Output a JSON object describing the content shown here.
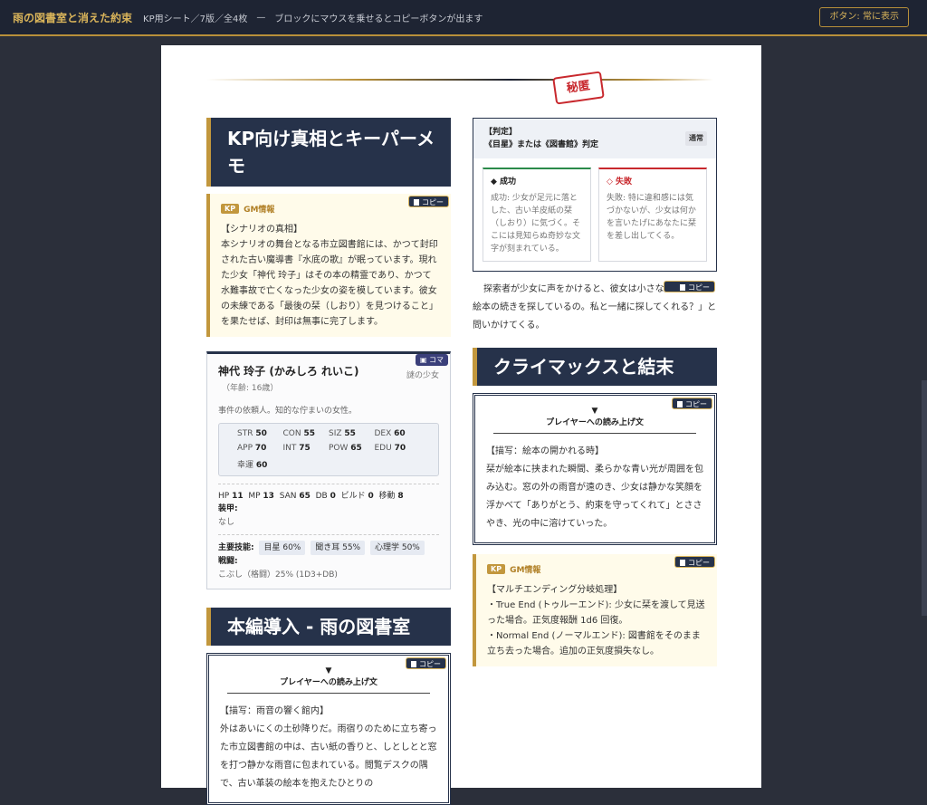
{
  "header": {
    "title": "雨の図書室と消えた約束",
    "subtitle": "KP用シート／7版／全4枚",
    "separator": "—",
    "hint": "ブロックにマウスを乗せるとコピーボタンが出ます",
    "button_label": "ボタン: 常に表示"
  },
  "stamp": "秘匿",
  "copy_label": "コピー",
  "left": {
    "section1_title": "KP向け真相とキーパーメモ",
    "gm1": {
      "badge": "KP",
      "label": "GM情報",
      "heading": "【シナリオの真相】",
      "body": "本シナリオの舞台となる市立図書館には、かつて封印された古い魔導書『水底の歌』が眠っています。現れた少女「神代 玲子」はその本の精霊であり、かつて水難事故で亡くなった少女の姿を模しています。彼女の未練である「最後の栞（しおり）を見つけること」を果たせば、封印は無事に完了します。"
    },
    "npc": {
      "koma_label": "コマ",
      "name": "神代 玲子 (かみしろ れいこ)",
      "role": "謎の少女",
      "age": "（年齢: 16歳）",
      "desc": "事件の依頼人。知的な佇まいの女性。",
      "stats": [
        {
          "k": "STR",
          "v": "50"
        },
        {
          "k": "CON",
          "v": "55"
        },
        {
          "k": "SIZ",
          "v": "55"
        },
        {
          "k": "DEX",
          "v": "60"
        },
        {
          "k": "APP",
          "v": "70"
        },
        {
          "k": "INT",
          "v": "75"
        },
        {
          "k": "POW",
          "v": "65"
        },
        {
          "k": "EDU",
          "v": "70"
        },
        {
          "k": "幸運",
          "v": "60"
        }
      ],
      "hp_k": "HP",
      "hp_v": "11",
      "mp_k": "MP",
      "mp_v": "13",
      "san_k": "SAN",
      "san_v": "65",
      "db_k": "DB",
      "db_v": "0",
      "build_k": "ビルド",
      "build_v": "0",
      "move_k": "移動",
      "move_v": "8",
      "armor_label": "装甲:",
      "armor_value": "なし",
      "skills_label": "主要技能:",
      "skills": [
        "目星 60%",
        "聞き耳 55%",
        "心理学 50%"
      ],
      "combat_label": "戦闘:",
      "combat_value": "こぶし（格闘）25% (1D3+DB)"
    },
    "section2_title": "本編導入 - 雨の図書室",
    "read1": {
      "mark": "▼",
      "title": "プレイヤーへの読み上げ文",
      "heading": "【描写：雨音の響く館内】",
      "body": "外はあいにくの土砂降りだ。雨宿りのために立ち寄った市立図書館の中は、古い紙の香りと、しとしとと窓を打つ静かな雨音に包まれている。閲覧デスクの隅で、古い革装の絵本を抱えたひとりの"
    }
  },
  "right": {
    "judge": {
      "label": "【判定】",
      "title": "《目星》または《図書館》判定",
      "difficulty": "通常",
      "success_label": "◆ 成功",
      "success_text": "成功: 少女が足元に落とした、古い羊皮紙の栞（しおり）に気づく。そこには見知らぬ奇妙な文字が刻まれている。",
      "fail_label": "◇ 失敗",
      "fail_text": "失敗: 特に違和感には気づかないが、少女は何かを言いたげにあなたに栞を差し出してくる。"
    },
    "prose": "探索者が少女に声をかけると、彼女は小さな声で「この絵本の続きを探しているの。私と一緒に探してくれる？」と問いかけてくる。",
    "section3_title": "クライマックスと結末",
    "read2": {
      "mark": "▼",
      "title": "プレイヤーへの読み上げ文",
      "heading": "【描写：絵本の開かれる時】",
      "body": "栞が絵本に挟まれた瞬間、柔らかな青い光が周囲を包み込む。窓の外の雨音が遠のき、少女は静かな笑顔を浮かべて「ありがとう、約束を守ってくれて」とささやき、光の中に溶けていった。"
    },
    "gm2": {
      "badge": "KP",
      "label": "GM情報",
      "heading": "【マルチエンディング分岐処理】",
      "line1": "・True End (トゥルーエンド): 少女に栞を渡して見送った場合。正気度報酬 1d6 回復。",
      "line2": "・Normal End (ノーマルエンド): 図書館をそのまま立ち去った場合。追加の正気度損失なし。"
    }
  }
}
